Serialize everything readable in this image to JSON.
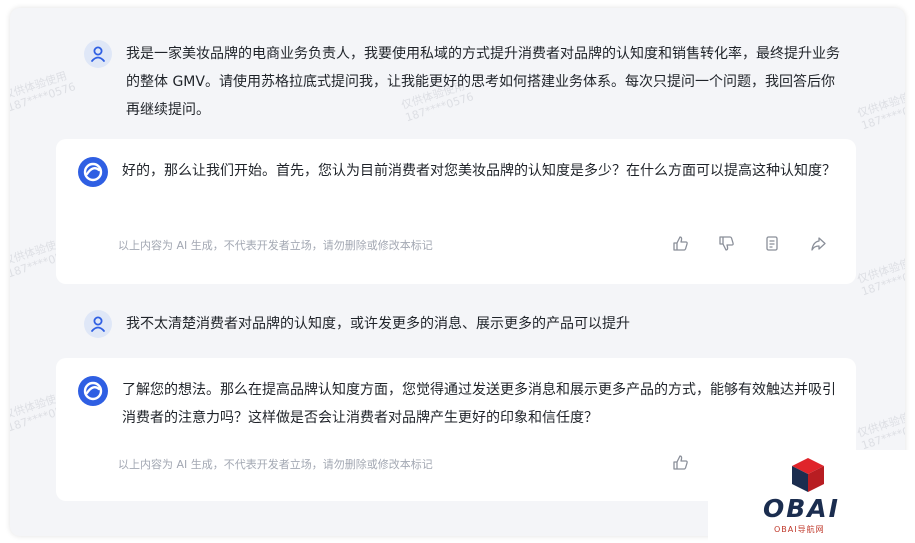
{
  "conversation": [
    {
      "role": "user",
      "text": "我是一家美妆品牌的电商业务负责人，我要使用私域的方式提升消费者对品牌的认知度和销售转化率，最终提升业务的整体 GMV。请使用苏格拉底式提问我，让我能更好的思考如何搭建业务体系。每次只提问一个问题，我回答后你再继续提问。"
    },
    {
      "role": "ai",
      "text": "好的，那么让我们开始。首先，您认为目前消费者对您美妆品牌的认知度是多少？在什么方面可以提高这种认知度？",
      "disclaimer": "以上内容为 AI 生成，不代表开发者立场，请勿删除或修改本标记"
    },
    {
      "role": "user",
      "text": "我不太清楚消费者对品牌的认知度，或许发更多的消息、展示更多的产品可以提升"
    },
    {
      "role": "ai",
      "text": "了解您的想法。那么在提高品牌认知度方面，您觉得通过发送更多消息和展示更多产品的方式，能够有效触达并吸引消费者的注意力吗？这样做是否会让消费者对品牌产生更好的印象和信任度？",
      "disclaimer": "以上内容为 AI 生成，不代表开发者立场，请勿删除或修改本标记"
    }
  ],
  "watermark": {
    "line1": "仅供体验使用",
    "line2": "187****0576"
  },
  "logo": {
    "text": "OBAI",
    "subtitle": "OBAI导航网"
  },
  "colors": {
    "accent": "#2f5fe3",
    "frame_bg": "#f4f5f8",
    "card_bg": "#ffffff",
    "text": "#1f2329",
    "muted": "#a3a8b3"
  }
}
